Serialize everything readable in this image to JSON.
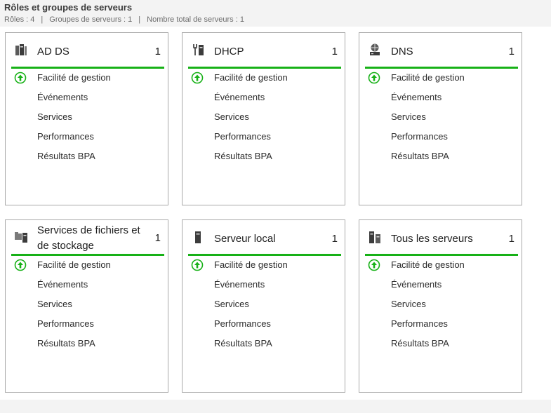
{
  "header": {
    "title": "Rôles et groupes de serveurs",
    "roles": "Rôles : 4",
    "groups": "Groupes de serveurs : 1",
    "total": "Nombre total de serveurs : 1",
    "separator": "|"
  },
  "accent_color": "#17b117",
  "tiles": [
    {
      "name": "AD DS",
      "count": "1",
      "icon": "ad-ds-icon",
      "rows": [
        "Facilité de gestion",
        "Événements",
        "Services",
        "Performances",
        "Résultats BPA"
      ],
      "status": "up-arrow-ok"
    },
    {
      "name": "DHCP",
      "count": "1",
      "icon": "dhcp-icon",
      "rows": [
        "Facilité de gestion",
        "Événements",
        "Services",
        "Performances",
        "Résultats BPA"
      ],
      "status": "up-arrow-ok"
    },
    {
      "name": "DNS",
      "count": "1",
      "icon": "dns-icon",
      "rows": [
        "Facilité de gestion",
        "Événements",
        "Services",
        "Performances",
        "Résultats BPA"
      ],
      "status": "up-arrow-ok"
    },
    {
      "name": "Services de fichiers et de stockage",
      "count": "1",
      "icon": "file-storage-icon",
      "rows": [
        "Facilité de gestion",
        "Événements",
        "Services",
        "Performances",
        "Résultats BPA"
      ],
      "status": "up-arrow-ok"
    },
    {
      "name": "Serveur local",
      "count": "1",
      "icon": "local-server-icon",
      "rows": [
        "Facilité de gestion",
        "Événements",
        "Services",
        "Performances",
        "Résultats BPA"
      ],
      "status": "up-arrow-ok"
    },
    {
      "name": "Tous les serveurs",
      "count": "1",
      "icon": "all-servers-icon",
      "rows": [
        "Facilité de gestion",
        "Événements",
        "Services",
        "Performances",
        "Résultats BPA"
      ],
      "status": "up-arrow-ok"
    }
  ]
}
